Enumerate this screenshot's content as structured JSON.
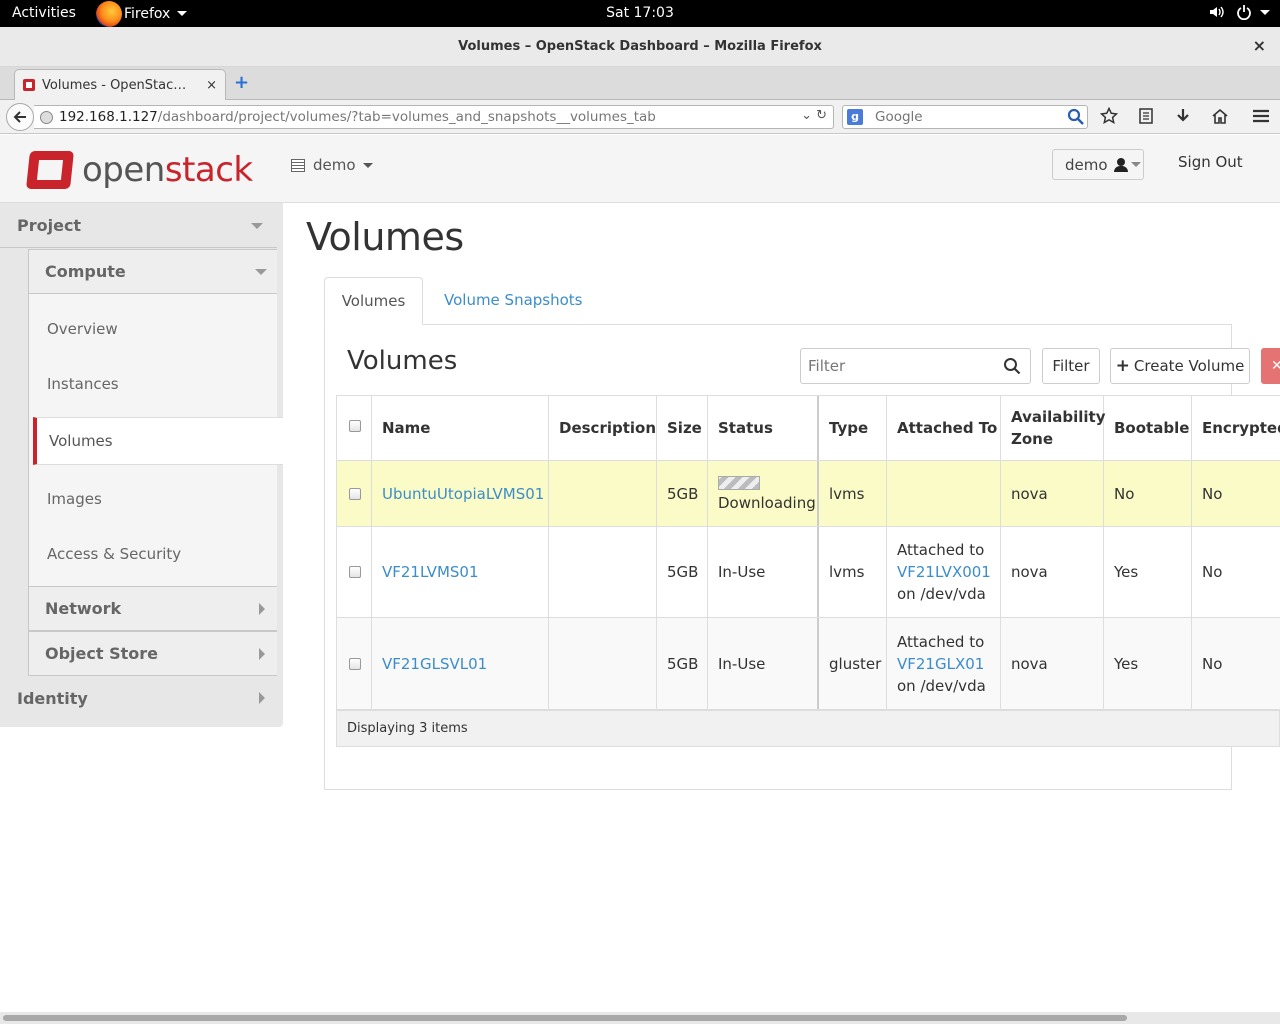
{
  "gnome": {
    "activities": "Activities",
    "app_name": "Firefox",
    "clock": "Sat 17:03"
  },
  "window": {
    "title": "Volumes – OpenStack Dashboard – Mozilla Firefox",
    "close": "×"
  },
  "browser": {
    "tab_label": "Volumes - OpenStac…",
    "tab_close": "×",
    "new_tab": "+",
    "url_host": "192.168.1.127",
    "url_path": "/dashboard/project/volumes/?tab=volumes_and_snapshots__volumes_tab",
    "search_placeholder": "Google",
    "search_engine_icon": "g",
    "icons": [
      "bookmark-star-icon",
      "reading-list-icon",
      "download-icon",
      "home-icon",
      "menu-icon"
    ]
  },
  "header": {
    "logo_open": "open",
    "logo_stack": "stack",
    "project": "demo",
    "user": "demo",
    "sign_out": "Sign Out"
  },
  "sidebar": {
    "project": "Project",
    "compute": "Compute",
    "items": [
      "Overview",
      "Instances",
      "Volumes",
      "Images",
      "Access & Security"
    ],
    "active": "Volumes",
    "network": "Network",
    "object_store": "Object Store",
    "identity": "Identity"
  },
  "main": {
    "page_title": "Volumes",
    "tabs": [
      {
        "label": "Volumes",
        "active": true
      },
      {
        "label": "Volume Snapshots",
        "active": false
      }
    ],
    "table_title": "Volumes",
    "filter_placeholder": "Filter",
    "filter_button": "Filter",
    "create_button": "Create Volume",
    "delete_button": "✕",
    "columns": [
      "Name",
      "Description",
      "Size",
      "Status",
      "Type",
      "Attached To",
      "Availability Zone",
      "Bootable",
      "Encrypted"
    ],
    "rows": [
      {
        "name": "UbuntuUtopiaLVMS01",
        "description": "",
        "size": "5GB",
        "status": "Downloading",
        "type": "lvms",
        "attached_prefix": "",
        "attached_instance": "",
        "attached_suffix": "",
        "zone": "nova",
        "bootable": "No",
        "encrypted": "No"
      },
      {
        "name": "VF21LVMS01",
        "description": "",
        "size": "5GB",
        "status": "In-Use",
        "type": "lvms",
        "attached_prefix": "Attached to",
        "attached_instance": "VF21LVX001",
        "attached_suffix": "on /dev/vda",
        "zone": "nova",
        "bootable": "Yes",
        "encrypted": "No"
      },
      {
        "name": "VF21GLSVL01",
        "description": "",
        "size": "5GB",
        "status": "In-Use",
        "type": "gluster",
        "attached_prefix": "Attached to",
        "attached_instance": "VF21GLX01",
        "attached_suffix": "on /dev/vda",
        "zone": "nova",
        "bootable": "Yes",
        "encrypted": "No"
      }
    ],
    "footer": "Displaying 3 items",
    "highlight_color": "#fbfbc7",
    "link_color": "#3b8dcb"
  }
}
